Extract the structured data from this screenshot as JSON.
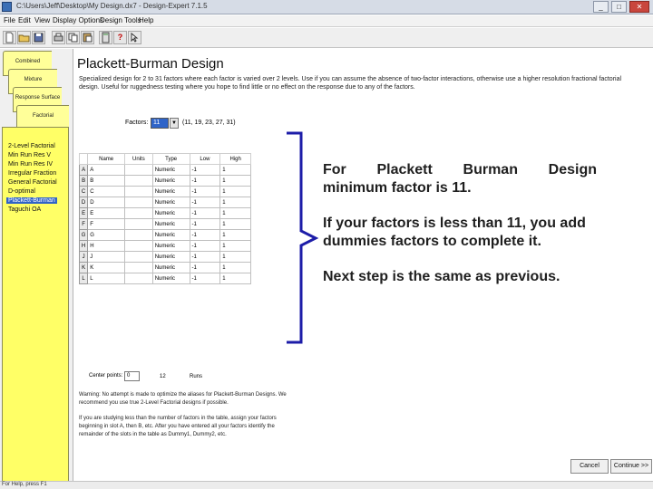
{
  "window": {
    "title": "C:\\Users\\Jeff\\Desktop\\My Design.dx7 - Design-Expert 7.1.5",
    "min": "_",
    "max": "□",
    "close": "✕"
  },
  "menu": [
    "File",
    "Edit",
    "View",
    "Display Options",
    "Design Tools",
    "Help"
  ],
  "toolbar": {
    "icons": [
      "new-file-icon",
      "open-folder-icon",
      "save-icon",
      "print-icon",
      "copy-icon",
      "paste-icon",
      "calculator-icon",
      "help-icon",
      "context-help-icon"
    ],
    "help_glyph": "?"
  },
  "nav": {
    "tabs": [
      "Combined",
      "Mixture",
      "Response Surface",
      "Factorial"
    ],
    "items": [
      "2-Level Factorial",
      "Min Run Res V",
      "Min Run Res IV",
      "Irregular Fraction",
      "General Factorial",
      "D-optimal",
      "Plackett-Burman",
      "Taguchi OA"
    ],
    "selected": "Plackett-Burman"
  },
  "main": {
    "title": "Plackett-Burman Design",
    "description": "Specialized design for 2 to 31 factors where each factor is varied over 2 levels. Use if you can assume the absence of two-factor interactions, otherwise use a higher resolution fractional factorial design. Useful for ruggedness testing where you hope to find little or no effect on the response due to any of the factors.",
    "factors_label": "Factors:",
    "factors_value": "11",
    "factors_note": "(11, 19, 23, 27, 31)",
    "table": {
      "headers": [
        "",
        "Name",
        "Units",
        "Type",
        "Low",
        "High"
      ],
      "rows": [
        {
          "key": "A",
          "name": "A",
          "units": "",
          "type": "Numeric",
          "low": "-1",
          "high": "1"
        },
        {
          "key": "B",
          "name": "B",
          "units": "",
          "type": "Numeric",
          "low": "-1",
          "high": "1"
        },
        {
          "key": "C",
          "name": "C",
          "units": "",
          "type": "Numeric",
          "low": "-1",
          "high": "1"
        },
        {
          "key": "D",
          "name": "D",
          "units": "",
          "type": "Numeric",
          "low": "-1",
          "high": "1"
        },
        {
          "key": "E",
          "name": "E",
          "units": "",
          "type": "Numeric",
          "low": "-1",
          "high": "1"
        },
        {
          "key": "F",
          "name": "F",
          "units": "",
          "type": "Numeric",
          "low": "-1",
          "high": "1"
        },
        {
          "key": "G",
          "name": "G",
          "units": "",
          "type": "Numeric",
          "low": "-1",
          "high": "1"
        },
        {
          "key": "H",
          "name": "H",
          "units": "",
          "type": "Numeric",
          "low": "-1",
          "high": "1"
        },
        {
          "key": "J",
          "name": "J",
          "units": "",
          "type": "Numeric",
          "low": "-1",
          "high": "1"
        },
        {
          "key": "K",
          "name": "K",
          "units": "",
          "type": "Numeric",
          "low": "-1",
          "high": "1"
        },
        {
          "key": "L",
          "name": "L",
          "units": "",
          "type": "Numeric",
          "low": "-1",
          "high": "1"
        }
      ]
    },
    "center_points_label": "Center points:",
    "center_points_value": "0",
    "runs_count": "12",
    "runs_label": "Runs",
    "warning": "Warning: No attempt is made to optimize the aliases for Plackett-Burman Designs. We recommend you use true 2-Level Factorial designs if possible.",
    "assign_note": "If you are studying less than the number of factors in the table, assign your factors beginning in slot A, then B, etc. After you have entered all your factors identify the remainder of the slots in the table as Dummy1, Dummy2, etc.",
    "cancel_label": "Cancel",
    "continue_label": "Continue >>"
  },
  "status": "For Help, press F1",
  "annotation": {
    "color": "#1c1ca8",
    "line1": "For Plackett Burman Design",
    "line2": "minimum factor is 11.",
    "line3": "If your factors is less than 11, you add dummies factors to complete it.",
    "line4": "Next step is the same as previous."
  }
}
